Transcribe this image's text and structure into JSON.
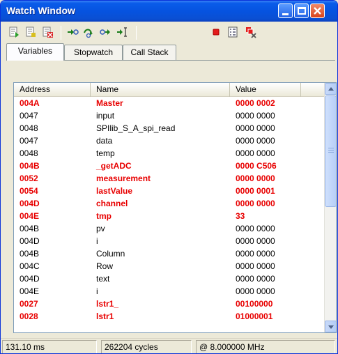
{
  "window": {
    "title": "Watch Window"
  },
  "toolbar": {
    "icons": [
      "add-watch-icon",
      "edit-watch-icon",
      "delete-watch-icon",
      "step-into-icon",
      "step-over-icon",
      "step-out-icon",
      "run-to-cursor-icon",
      "breakpoint-icon",
      "properties-icon",
      "clear-breakpoints-icon"
    ]
  },
  "tabs": [
    {
      "label": "Variables",
      "active": true
    },
    {
      "label": "Stopwatch",
      "active": false
    },
    {
      "label": "Call Stack",
      "active": false
    }
  ],
  "columns": [
    "Address",
    "Name",
    "Value"
  ],
  "rows": [
    {
      "address": "004A",
      "name": "Master",
      "value": "0000 0002",
      "changed": true
    },
    {
      "address": "0047",
      "name": "input",
      "value": "0000 0000",
      "changed": false
    },
    {
      "address": "0048",
      "name": "SPIlib_S_A_spi_read",
      "value": "0000 0000",
      "changed": false
    },
    {
      "address": "0047",
      "name": "data",
      "value": "0000 0000",
      "changed": false
    },
    {
      "address": "0048",
      "name": "temp",
      "value": "0000 0000",
      "changed": false
    },
    {
      "address": "004B",
      "name": "_getADC",
      "value": "0000 C506",
      "changed": true
    },
    {
      "address": "0052",
      "name": "measurement",
      "value": "0000 0000",
      "changed": true
    },
    {
      "address": "0054",
      "name": "lastValue",
      "value": "0000 0001",
      "changed": true
    },
    {
      "address": "004D",
      "name": "channel",
      "value": "0000 0000",
      "changed": true
    },
    {
      "address": "004E",
      "name": "tmp",
      "value": "33",
      "changed": true
    },
    {
      "address": "004B",
      "name": "pv",
      "value": "0000 0000",
      "changed": false
    },
    {
      "address": "004D",
      "name": "i",
      "value": "0000 0000",
      "changed": false
    },
    {
      "address": "004B",
      "name": "Column",
      "value": "0000 0000",
      "changed": false
    },
    {
      "address": "004C",
      "name": "Row",
      "value": "0000 0000",
      "changed": false
    },
    {
      "address": "004D",
      "name": "text",
      "value": "0000 0000",
      "changed": false
    },
    {
      "address": "004E",
      "name": "i",
      "value": "0000 0000",
      "changed": false
    },
    {
      "address": "0027",
      "name": "lstr1_",
      "value": "00100000",
      "changed": true
    },
    {
      "address": "0028",
      "name": "lstr1",
      "value": "01000001",
      "changed": true
    }
  ],
  "status": {
    "time": "131.10 ms",
    "cycles": "262204 cycles",
    "frequency": "@ 8.000000 MHz"
  },
  "colors": {
    "changed": "#e80000",
    "titlebar": "#0653e0"
  }
}
